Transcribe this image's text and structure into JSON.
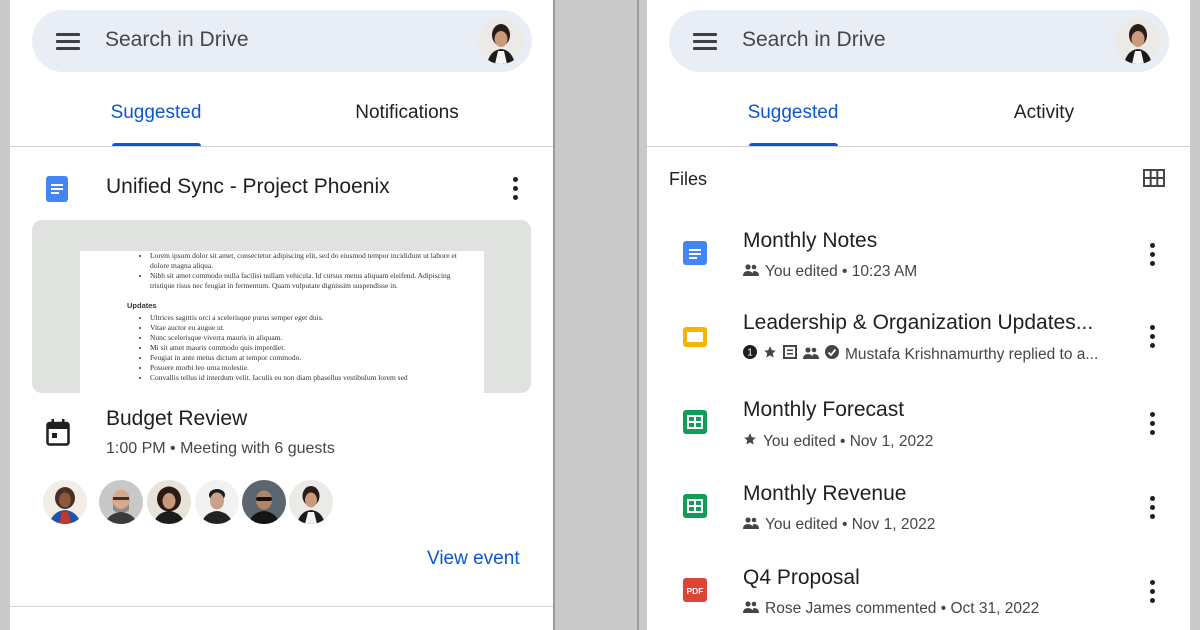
{
  "left": {
    "search_placeholder": "Search in Drive",
    "tabs": [
      {
        "label": "Suggested",
        "active": true
      },
      {
        "label": "Notifications",
        "active": false
      }
    ],
    "doc_card": {
      "title": "Unified Sync - Project Phoenix",
      "preview_bullets_top": [
        "Lorem ipsum dolor sit amet, consectetur adipiscing elit, sed do eiusmod tempor incididunt ut labore et dolore magna aliqua.",
        "Nibh sit amet commodo nulla facilisi nullam vehicula. Id cursus metus aliquam eleifend. Adipiscing tristique risus nec feugiat in fermentum. Quam vulputate dignissim suspendisse in."
      ],
      "preview_heading": "Updates",
      "preview_bullets_updates": [
        "Ultrices sagittis orci a scelerisque purus semper eget duis.",
        "Vitae auctor eu augue ut.",
        "Nunc scelerisque viverra mauris in aliquam.",
        "Mi sit amet mauris commodo quis imperdiet.",
        "Feugiat in ante metus dictum at tempor commodo.",
        "Posuere morbi leo urna molestie.",
        "Convallis tellus id interdum velit. Iaculis eu non diam phasellus vestibulum lorem sed"
      ]
    },
    "event_card": {
      "title": "Budget Review",
      "subtitle": "1:00 PM • Meeting with 6 guests",
      "action": "View event"
    }
  },
  "right": {
    "search_placeholder": "Search in Drive",
    "tabs": [
      {
        "label": "Suggested",
        "active": true
      },
      {
        "label": "Activity",
        "active": false
      }
    ],
    "section_label": "Files",
    "files": [
      {
        "title": "Monthly Notes",
        "sub": "You edited • 10:23 AM",
        "icon": "docs-icon",
        "color": "#4285f4"
      },
      {
        "title": "Leadership & Organization Updates...",
        "sub": "Mustafa Krishnamurthy replied to a...",
        "icon": "slides-icon",
        "color": "#f4b400"
      },
      {
        "title": "Monthly Forecast",
        "sub": "You edited • Nov 1, 2022",
        "icon": "sheets-icon",
        "color": "#0f9d58"
      },
      {
        "title": "Monthly Revenue",
        "sub": "You edited • Nov 1, 2022",
        "icon": "sheets-icon",
        "color": "#0f9d58"
      },
      {
        "title": "Q4 Proposal",
        "sub": "Rose James commented • Oct 31, 2022",
        "icon": "pdf-icon",
        "color": "#db4437"
      }
    ],
    "pdf_label": "PDF",
    "badge_count": "1"
  },
  "colors": {
    "accent": "#0b57d0",
    "search_bg": "#e9eef6"
  }
}
